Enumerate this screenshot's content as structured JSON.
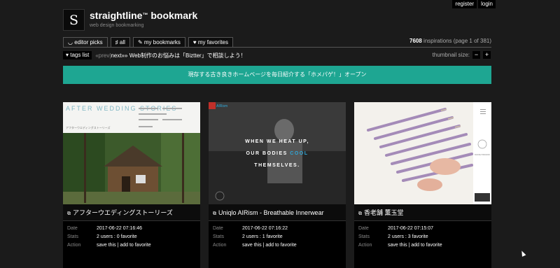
{
  "topnav": {
    "register": "register",
    "login": "login"
  },
  "brand": {
    "logo": "S",
    "title": "straightline",
    "tm": "™",
    "title2": " bookmark",
    "subtitle": "web design bookmarking"
  },
  "tabs": [
    {
      "icon": "◡",
      "label": "editor picks"
    },
    {
      "icon": "♯",
      "label": "all"
    },
    {
      "icon": "✎",
      "label": "my bookmarks"
    },
    {
      "icon": "♥",
      "label": "my favorites"
    }
  ],
  "count": {
    "num": "7608",
    "rest": " inspirations (page 1 of 381)"
  },
  "bar": {
    "tags": "▾ tags list",
    "prev": "«prev",
    "sep": " | ",
    "next": "next»",
    "promo": " » Web制作のお悩みは「Biztter」で相談しよう！"
  },
  "thumbsize": {
    "label": "thumbnail size:",
    "minus": "−",
    "plus": "+"
  },
  "banner": "現存する古き良きホームページを毎日紹介する「ホメパゲ！」オープン",
  "meta_labels": {
    "date": "Date",
    "stats": "Stats",
    "action": "Action"
  },
  "cards": [
    {
      "title": "アフターウエディングストーリーズ",
      "date": "2017-06-22 07:16:46",
      "stats": "2 users : 0 favorite",
      "action": "save this | add to favorite",
      "thumb": {
        "heading": "AFTER WEDDING STORIES",
        "sub": "アフターウエディングストーリーズ"
      }
    },
    {
      "title": "Uniqlo AIRism - Breathable Innerwear",
      "date": "2017-06-22 07:16:22",
      "stats": "2 users : 1 favorite",
      "action": "save this | add to favorite",
      "thumb": {
        "line1": "WHEN WE HEAT UP,",
        "line2a": "OUR BODIES ",
        "line2b": "COOL",
        "line3": "THEMSELVES.",
        "brand": "UNI QLO",
        "product": "AIRism"
      }
    },
    {
      "title": "香老舗 薫玉堂",
      "date": "2017-06-22 07:15:07",
      "stats": "2 users : 3 favorite",
      "action": "save this | add to favorite",
      "thumb": {
        "brand": "KUNGYOKUDO"
      }
    }
  ],
  "colors": {
    "accent": "#1ea692",
    "cool": "#2fa7d8",
    "background": "#1b1b1b"
  }
}
